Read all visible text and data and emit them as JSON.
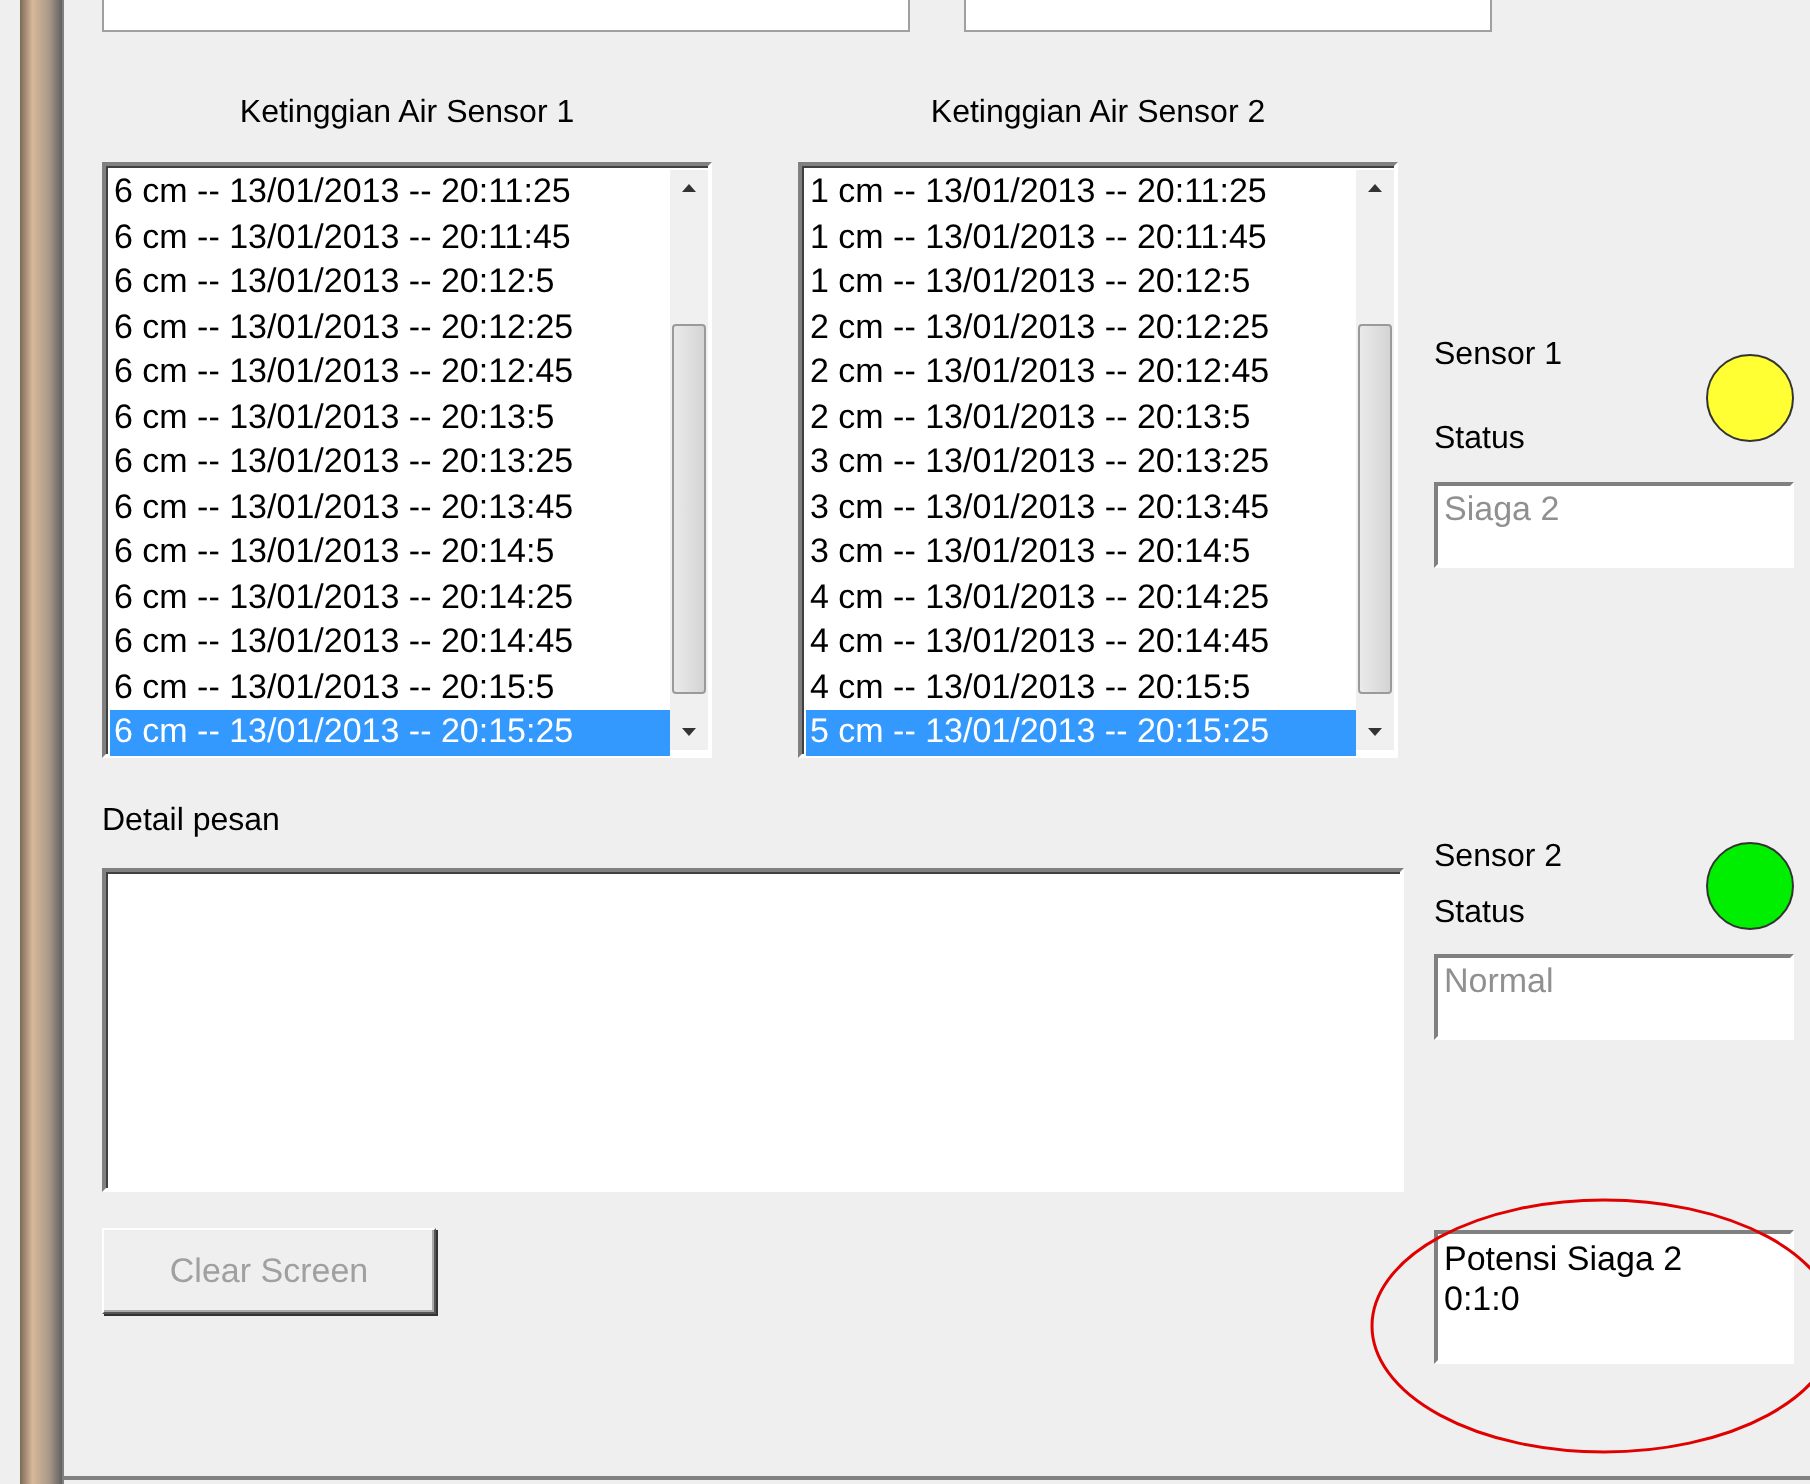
{
  "lists": [
    {
      "title": "Ketinggian Air Sensor 1",
      "items": [
        {
          "text": "6 cm -- 13/01/2013 -- 20:11:25",
          "selected": false
        },
        {
          "text": "6 cm -- 13/01/2013 -- 20:11:45",
          "selected": false
        },
        {
          "text": "6 cm -- 13/01/2013 -- 20:12:5",
          "selected": false
        },
        {
          "text": "6 cm -- 13/01/2013 -- 20:12:25",
          "selected": false
        },
        {
          "text": "6 cm -- 13/01/2013 -- 20:12:45",
          "selected": false
        },
        {
          "text": "6 cm -- 13/01/2013 -- 20:13:5",
          "selected": false
        },
        {
          "text": "6 cm -- 13/01/2013 -- 20:13:25",
          "selected": false
        },
        {
          "text": "6 cm -- 13/01/2013 -- 20:13:45",
          "selected": false
        },
        {
          "text": "6 cm -- 13/01/2013 -- 20:14:5",
          "selected": false
        },
        {
          "text": "6 cm -- 13/01/2013 -- 20:14:25",
          "selected": false
        },
        {
          "text": "6 cm -- 13/01/2013 -- 20:14:45",
          "selected": false
        },
        {
          "text": "6 cm -- 13/01/2013 -- 20:15:5",
          "selected": false
        },
        {
          "text": "6 cm -- 13/01/2013 -- 20:15:25",
          "selected": true
        }
      ]
    },
    {
      "title": "Ketinggian Air Sensor 2",
      "items": [
        {
          "text": "1 cm -- 13/01/2013 -- 20:11:25",
          "selected": false
        },
        {
          "text": "1 cm -- 13/01/2013 -- 20:11:45",
          "selected": false
        },
        {
          "text": "1 cm -- 13/01/2013 -- 20:12:5",
          "selected": false
        },
        {
          "text": "2 cm -- 13/01/2013 -- 20:12:25",
          "selected": false
        },
        {
          "text": "2 cm -- 13/01/2013 -- 20:12:45",
          "selected": false
        },
        {
          "text": "2 cm -- 13/01/2013 -- 20:13:5",
          "selected": false
        },
        {
          "text": "3 cm -- 13/01/2013 -- 20:13:25",
          "selected": false
        },
        {
          "text": "3 cm -- 13/01/2013 -- 20:13:45",
          "selected": false
        },
        {
          "text": "3 cm -- 13/01/2013 -- 20:14:5",
          "selected": false
        },
        {
          "text": "4 cm -- 13/01/2013 -- 20:14:25",
          "selected": false
        },
        {
          "text": "4 cm -- 13/01/2013 -- 20:14:45",
          "selected": false
        },
        {
          "text": "4 cm -- 13/01/2013 -- 20:15:5",
          "selected": false
        },
        {
          "text": "5 cm -- 13/01/2013 -- 20:15:25",
          "selected": true
        }
      ]
    }
  ],
  "detail": {
    "label": "Detail pesan"
  },
  "clear_button": {
    "label": "Clear Screen",
    "disabled": true
  },
  "sensors": [
    {
      "name": "Sensor 1",
      "status_label": "Status",
      "color": "#ffff33",
      "value": "Siaga 2"
    },
    {
      "name": "Sensor 2",
      "status_label": "Status",
      "color": "#00ee00",
      "value": "Normal"
    }
  ],
  "summary": {
    "lines": [
      "Potensi Siaga 2",
      "0:1:0"
    ]
  }
}
